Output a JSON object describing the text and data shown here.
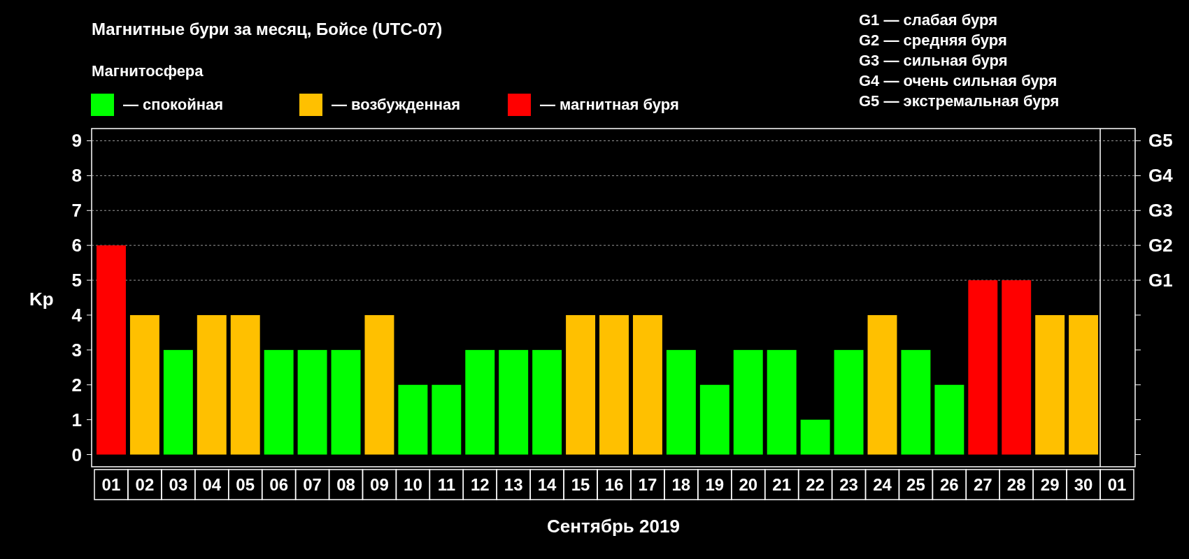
{
  "title": "Магнитные бури за месяц, Бойсе (UTC-07)",
  "legend_title": "Магнитосфера",
  "legend_dash": "—",
  "storm_scale": [
    "G1 — слабая буря",
    "G2 — средняя буря",
    "G3 — сильная буря",
    "G4 — очень сильная буря",
    "G5 — экстремальная буря"
  ],
  "chart_data": {
    "type": "bar",
    "stacked": true,
    "grid": true,
    "xlabel": "Сентябрь 2019",
    "ylabel": "Kp",
    "categories": [
      "01",
      "02",
      "03",
      "04",
      "05",
      "06",
      "07",
      "08",
      "09",
      "10",
      "11",
      "12",
      "13",
      "14",
      "15",
      "16",
      "17",
      "18",
      "19",
      "20",
      "21",
      "22",
      "23",
      "24",
      "25",
      "26",
      "27",
      "28",
      "29",
      "30",
      "01"
    ],
    "series": [
      {
        "name": "спокойная",
        "color": "#00ff00",
        "values": [
          null,
          null,
          3,
          null,
          null,
          3,
          3,
          3,
          null,
          2,
          2,
          3,
          3,
          3,
          null,
          null,
          null,
          3,
          2,
          3,
          3,
          1,
          3,
          null,
          3,
          2,
          null,
          null,
          null,
          null,
          null
        ]
      },
      {
        "name": "возбужденная",
        "color": "#ffc000",
        "values": [
          null,
          4,
          null,
          4,
          4,
          null,
          null,
          null,
          4,
          null,
          null,
          null,
          null,
          null,
          4,
          4,
          4,
          null,
          null,
          null,
          null,
          null,
          null,
          4,
          null,
          null,
          null,
          null,
          4,
          4,
          null
        ]
      },
      {
        "name": "магнитная буря",
        "color": "#ff0000",
        "values": [
          6,
          null,
          null,
          null,
          null,
          null,
          null,
          null,
          null,
          null,
          null,
          null,
          null,
          null,
          null,
          null,
          null,
          null,
          null,
          null,
          null,
          null,
          null,
          null,
          null,
          null,
          5,
          5,
          null,
          null,
          null
        ]
      }
    ],
    "ylim": [
      -0.35,
      9.35
    ],
    "yticks": [
      0,
      1,
      2,
      3,
      4,
      5,
      6,
      7,
      8,
      9
    ],
    "annotations": [
      "G1",
      "G2",
      "G3",
      "G4",
      "G5"
    ]
  }
}
